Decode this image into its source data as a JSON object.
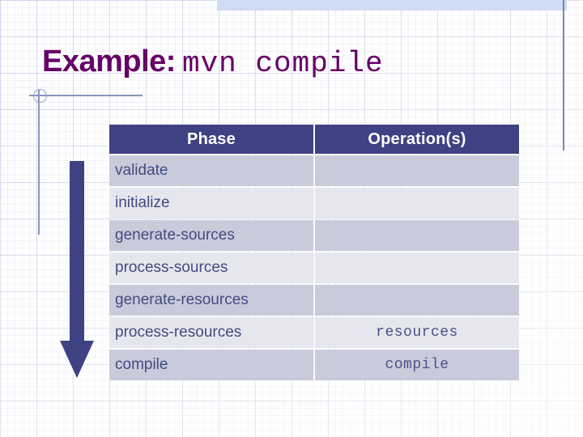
{
  "slide": {
    "title_prefix": "Example:",
    "title_command": "mvn compile"
  },
  "decor": {
    "top_band_color": "#cfdcf3",
    "rule_color": "#7b87ab",
    "arrow_color": "#3f4282",
    "arrow_name": "down-arrow"
  },
  "table": {
    "headers": {
      "phase": "Phase",
      "operations": "Operation(s)"
    },
    "header_bg": "#3f4282",
    "header_fg": "#ffffff",
    "row_odd_bg": "#c9cbdb",
    "row_even_bg": "#e6e7ee",
    "row_fg": "#424b82",
    "rows": [
      {
        "phase": "validate",
        "operations": ""
      },
      {
        "phase": "initialize",
        "operations": ""
      },
      {
        "phase": "generate-sources",
        "operations": ""
      },
      {
        "phase": "process-sources",
        "operations": ""
      },
      {
        "phase": "generate-resources",
        "operations": ""
      },
      {
        "phase": "process-resources",
        "operations": "resources"
      },
      {
        "phase": "compile",
        "operations": "compile"
      }
    ]
  },
  "theme": {
    "title_color": "#660066",
    "grid_line_color": "#969bc8",
    "background": "#fdfdfd"
  }
}
